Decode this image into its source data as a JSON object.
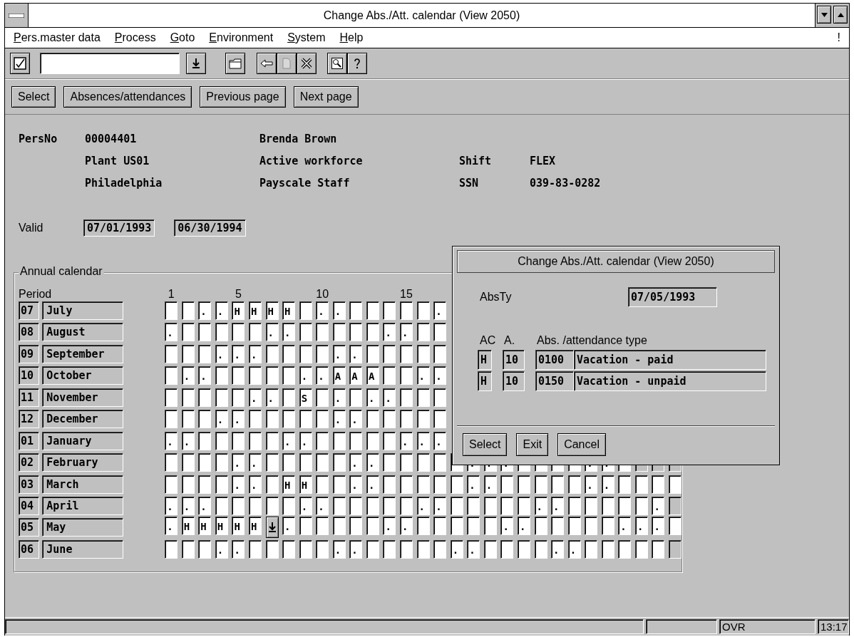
{
  "window": {
    "title": "Change Abs./Att. calendar (View 2050)"
  },
  "menu": {
    "items": [
      "Pers.master data",
      "Process",
      "Goto",
      "Environment",
      "System",
      "Help"
    ],
    "right_mark": "!"
  },
  "app_toolbar": {
    "buttons": [
      "Select",
      "Absences/attendances",
      "Previous page",
      "Next page"
    ]
  },
  "employee": {
    "pers_no_label": "PersNo",
    "pers_no": "00004401",
    "name": "Brenda Brown",
    "plant": "Plant US01",
    "status": "Active workforce",
    "shift_label": "Shift",
    "shift": "FLEX",
    "city": "Philadelphia",
    "payscale": "Payscale Staff",
    "ssn_label": "SSN",
    "ssn": "039-83-0282"
  },
  "validity": {
    "label": "Valid",
    "from": "07/01/1993",
    "to": "06/30/1994"
  },
  "calendar": {
    "title": "Annual calendar",
    "period_label": "Period",
    "day_ticks": [
      "1",
      "5",
      "10",
      "15"
    ],
    "rows": [
      {
        "code": "07",
        "month": "July",
        "cells": [
          {
            "kind": "day"
          },
          {
            "kind": "day"
          },
          {
            "kind": "day",
            "text": "."
          },
          {
            "kind": "day",
            "text": "."
          },
          {
            "kind": "day",
            "text": "H"
          },
          {
            "kind": "day",
            "text": "H"
          },
          {
            "kind": "day",
            "text": "H"
          },
          {
            "kind": "day",
            "text": "H"
          },
          {
            "kind": "day"
          },
          {
            "kind": "day",
            "text": "."
          },
          {
            "kind": "day",
            "text": "."
          },
          {
            "kind": "day"
          },
          {
            "kind": "day"
          },
          {
            "kind": "day"
          },
          {
            "kind": "day"
          },
          {
            "kind": "day"
          },
          {
            "kind": "day",
            "text": "."
          }
        ]
      },
      {
        "code": "08",
        "month": "August",
        "cells": [
          {
            "kind": "day",
            "text": "."
          },
          {
            "kind": "day"
          },
          {
            "kind": "day"
          },
          {
            "kind": "day"
          },
          {
            "kind": "day"
          },
          {
            "kind": "day"
          },
          {
            "kind": "day",
            "text": "."
          },
          {
            "kind": "day",
            "text": "."
          },
          {
            "kind": "day"
          },
          {
            "kind": "day"
          },
          {
            "kind": "day"
          },
          {
            "kind": "day"
          },
          {
            "kind": "day"
          },
          {
            "kind": "day",
            "text": "."
          },
          {
            "kind": "day",
            "text": "."
          },
          {
            "kind": "day"
          },
          {
            "kind": "day"
          }
        ]
      },
      {
        "code": "09",
        "month": "September",
        "cells": [
          {
            "kind": "day"
          },
          {
            "kind": "day"
          },
          {
            "kind": "day"
          },
          {
            "kind": "day",
            "text": "."
          },
          {
            "kind": "day",
            "text": "."
          },
          {
            "kind": "day",
            "text": "."
          },
          {
            "kind": "day"
          },
          {
            "kind": "day"
          },
          {
            "kind": "day"
          },
          {
            "kind": "day"
          },
          {
            "kind": "day",
            "text": "."
          },
          {
            "kind": "day",
            "text": "."
          },
          {
            "kind": "day"
          },
          {
            "kind": "day"
          },
          {
            "kind": "day"
          },
          {
            "kind": "day"
          },
          {
            "kind": "day"
          }
        ]
      },
      {
        "code": "10",
        "month": "October",
        "cells": [
          {
            "kind": "day"
          },
          {
            "kind": "day",
            "text": "."
          },
          {
            "kind": "day",
            "text": "."
          },
          {
            "kind": "day"
          },
          {
            "kind": "day"
          },
          {
            "kind": "day"
          },
          {
            "kind": "day"
          },
          {
            "kind": "day"
          },
          {
            "kind": "day",
            "text": "."
          },
          {
            "kind": "day",
            "text": "."
          },
          {
            "kind": "day",
            "text": "A"
          },
          {
            "kind": "day",
            "text": "A"
          },
          {
            "kind": "day",
            "text": "A"
          },
          {
            "kind": "day"
          },
          {
            "kind": "day"
          },
          {
            "kind": "day",
            "text": "."
          },
          {
            "kind": "day",
            "text": "."
          }
        ]
      },
      {
        "code": "11",
        "month": "November",
        "cells": [
          {
            "kind": "day"
          },
          {
            "kind": "day"
          },
          {
            "kind": "day"
          },
          {
            "kind": "day"
          },
          {
            "kind": "day"
          },
          {
            "kind": "day",
            "text": "."
          },
          {
            "kind": "day",
            "text": "."
          },
          {
            "kind": "day"
          },
          {
            "kind": "day",
            "text": "S"
          },
          {
            "kind": "day"
          },
          {
            "kind": "day",
            "text": "."
          },
          {
            "kind": "day"
          },
          {
            "kind": "day",
            "text": "."
          },
          {
            "kind": "day",
            "text": "."
          },
          {
            "kind": "day"
          },
          {
            "kind": "day"
          },
          {
            "kind": "day"
          }
        ]
      },
      {
        "code": "12",
        "month": "December",
        "cells": [
          {
            "kind": "day"
          },
          {
            "kind": "day"
          },
          {
            "kind": "day"
          },
          {
            "kind": "day",
            "text": "."
          },
          {
            "kind": "day",
            "text": "."
          },
          {
            "kind": "day"
          },
          {
            "kind": "day"
          },
          {
            "kind": "day"
          },
          {
            "kind": "day"
          },
          {
            "kind": "day"
          },
          {
            "kind": "day",
            "text": "."
          },
          {
            "kind": "day",
            "text": "."
          },
          {
            "kind": "day"
          },
          {
            "kind": "day"
          },
          {
            "kind": "day"
          },
          {
            "kind": "day"
          },
          {
            "kind": "day"
          }
        ]
      },
      {
        "code": "01",
        "month": "January",
        "cells": [
          {
            "kind": "day",
            "text": "."
          },
          {
            "kind": "day",
            "text": "."
          },
          {
            "kind": "day"
          },
          {
            "kind": "day"
          },
          {
            "kind": "day"
          },
          {
            "kind": "day"
          },
          {
            "kind": "day"
          },
          {
            "kind": "day",
            "text": "."
          },
          {
            "kind": "day",
            "text": "."
          },
          {
            "kind": "day"
          },
          {
            "kind": "day"
          },
          {
            "kind": "day"
          },
          {
            "kind": "day"
          },
          {
            "kind": "day"
          },
          {
            "kind": "day",
            "text": "."
          },
          {
            "kind": "day",
            "text": "."
          },
          {
            "kind": "day",
            "text": "."
          }
        ]
      },
      {
        "code": "02",
        "month": "February",
        "cells": [
          {
            "kind": "day"
          },
          {
            "kind": "day"
          },
          {
            "kind": "day"
          },
          {
            "kind": "day"
          },
          {
            "kind": "day",
            "text": "."
          },
          {
            "kind": "day",
            "text": "."
          },
          {
            "kind": "day"
          },
          {
            "kind": "day"
          },
          {
            "kind": "day"
          },
          {
            "kind": "day"
          },
          {
            "kind": "day"
          },
          {
            "kind": "day",
            "text": "."
          },
          {
            "kind": "day",
            "text": "."
          },
          {
            "kind": "day"
          },
          {
            "kind": "day"
          },
          {
            "kind": "day"
          },
          {
            "kind": "day"
          },
          {
            "kind": "day"
          },
          {
            "kind": "day",
            "text": "."
          },
          {
            "kind": "day",
            "text": "."
          },
          {
            "kind": "day",
            "text": "."
          },
          {
            "kind": "day"
          },
          {
            "kind": "day"
          },
          {
            "kind": "day"
          },
          {
            "kind": "day"
          },
          {
            "kind": "day",
            "text": "."
          },
          {
            "kind": "day",
            "text": "."
          },
          {
            "kind": "day"
          },
          {
            "kind": "none"
          },
          {
            "kind": "none"
          },
          {
            "kind": "none"
          }
        ]
      },
      {
        "code": "03",
        "month": "March",
        "cells": [
          {
            "kind": "day"
          },
          {
            "kind": "day"
          },
          {
            "kind": "day"
          },
          {
            "kind": "day"
          },
          {
            "kind": "day",
            "text": "."
          },
          {
            "kind": "day",
            "text": "."
          },
          {
            "kind": "day"
          },
          {
            "kind": "day",
            "text": "H"
          },
          {
            "kind": "day",
            "text": "H"
          },
          {
            "kind": "day"
          },
          {
            "kind": "day"
          },
          {
            "kind": "day",
            "text": "."
          },
          {
            "kind": "day",
            "text": "."
          },
          {
            "kind": "day"
          },
          {
            "kind": "day"
          },
          {
            "kind": "day"
          },
          {
            "kind": "day"
          },
          {
            "kind": "day"
          },
          {
            "kind": "day",
            "text": "."
          },
          {
            "kind": "day",
            "text": "."
          },
          {
            "kind": "day"
          },
          {
            "kind": "day"
          },
          {
            "kind": "day"
          },
          {
            "kind": "day"
          },
          {
            "kind": "day"
          },
          {
            "kind": "day",
            "text": "."
          },
          {
            "kind": "day",
            "text": "."
          },
          {
            "kind": "day"
          },
          {
            "kind": "day"
          },
          {
            "kind": "day"
          },
          {
            "kind": "day"
          }
        ]
      },
      {
        "code": "04",
        "month": "April",
        "cells": [
          {
            "kind": "day",
            "text": "."
          },
          {
            "kind": "day",
            "text": "."
          },
          {
            "kind": "day",
            "text": "."
          },
          {
            "kind": "day"
          },
          {
            "kind": "day"
          },
          {
            "kind": "day"
          },
          {
            "kind": "day"
          },
          {
            "kind": "day"
          },
          {
            "kind": "day",
            "text": "."
          },
          {
            "kind": "day",
            "text": "."
          },
          {
            "kind": "day"
          },
          {
            "kind": "day"
          },
          {
            "kind": "day"
          },
          {
            "kind": "day"
          },
          {
            "kind": "day"
          },
          {
            "kind": "day",
            "text": "."
          },
          {
            "kind": "day",
            "text": "."
          },
          {
            "kind": "day"
          },
          {
            "kind": "day"
          },
          {
            "kind": "day"
          },
          {
            "kind": "day"
          },
          {
            "kind": "day"
          },
          {
            "kind": "day",
            "text": "."
          },
          {
            "kind": "day",
            "text": "."
          },
          {
            "kind": "day"
          },
          {
            "kind": "day"
          },
          {
            "kind": "day"
          },
          {
            "kind": "day"
          },
          {
            "kind": "day"
          },
          {
            "kind": "day",
            "text": "."
          },
          {
            "kind": "none"
          }
        ]
      },
      {
        "code": "05",
        "month": "May",
        "cells": [
          {
            "kind": "day",
            "text": "."
          },
          {
            "kind": "day",
            "text": "H"
          },
          {
            "kind": "day",
            "text": "H"
          },
          {
            "kind": "day",
            "text": "H"
          },
          {
            "kind": "day",
            "text": "H"
          },
          {
            "kind": "day",
            "text": "H"
          },
          {
            "kind": "button"
          },
          {
            "kind": "day",
            "text": "."
          },
          {
            "kind": "day"
          },
          {
            "kind": "day"
          },
          {
            "kind": "day"
          },
          {
            "kind": "day"
          },
          {
            "kind": "day"
          },
          {
            "kind": "day",
            "text": "."
          },
          {
            "kind": "day",
            "text": "."
          },
          {
            "kind": "day"
          },
          {
            "kind": "day"
          },
          {
            "kind": "day"
          },
          {
            "kind": "day"
          },
          {
            "kind": "day"
          },
          {
            "kind": "day",
            "text": "."
          },
          {
            "kind": "day",
            "text": "."
          },
          {
            "kind": "day"
          },
          {
            "kind": "day"
          },
          {
            "kind": "day"
          },
          {
            "kind": "day"
          },
          {
            "kind": "day"
          },
          {
            "kind": "day",
            "text": "."
          },
          {
            "kind": "day",
            "text": "."
          },
          {
            "kind": "day",
            "text": "."
          },
          {
            "kind": "day"
          }
        ]
      },
      {
        "code": "06",
        "month": "June",
        "cells": [
          {
            "kind": "day"
          },
          {
            "kind": "day"
          },
          {
            "kind": "day"
          },
          {
            "kind": "day",
            "text": "."
          },
          {
            "kind": "day",
            "text": "."
          },
          {
            "kind": "day"
          },
          {
            "kind": "day"
          },
          {
            "kind": "day"
          },
          {
            "kind": "day"
          },
          {
            "kind": "day"
          },
          {
            "kind": "day",
            "text": "."
          },
          {
            "kind": "day",
            "text": "."
          },
          {
            "kind": "day"
          },
          {
            "kind": "day"
          },
          {
            "kind": "day"
          },
          {
            "kind": "day"
          },
          {
            "kind": "day"
          },
          {
            "kind": "day",
            "text": "."
          },
          {
            "kind": "day",
            "text": "."
          },
          {
            "kind": "day"
          },
          {
            "kind": "day"
          },
          {
            "kind": "day"
          },
          {
            "kind": "day"
          },
          {
            "kind": "day",
            "text": "."
          },
          {
            "kind": "day",
            "text": "."
          },
          {
            "kind": "day"
          },
          {
            "kind": "day"
          },
          {
            "kind": "day"
          },
          {
            "kind": "day"
          },
          {
            "kind": "day"
          },
          {
            "kind": "none"
          }
        ]
      }
    ]
  },
  "dialog": {
    "title": "Change Abs./Att. calendar (View 2050)",
    "absty_label": "AbsTy",
    "absty_value": "07/05/1993",
    "columns": [
      "AC",
      "A.",
      "Abs. /attendance type"
    ],
    "rows": [
      {
        "ac": "H",
        "a": "10",
        "code": "0100",
        "text": "Vacation - paid"
      },
      {
        "ac": "H",
        "a": "10",
        "code": "0150",
        "text": "Vacation - unpaid"
      }
    ],
    "buttons": [
      "Select",
      "Exit",
      "Cancel"
    ]
  },
  "status_bar": {
    "mode": "OVR",
    "time": "13:17"
  }
}
